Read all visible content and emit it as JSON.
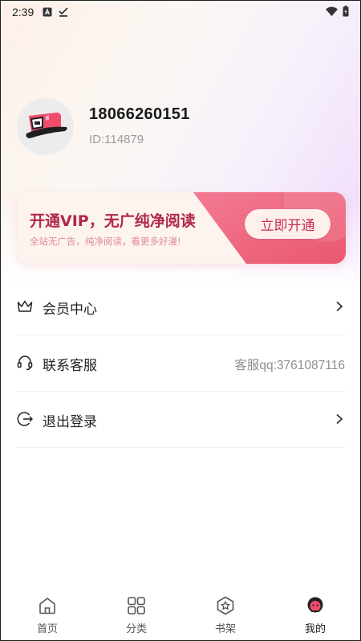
{
  "status_bar": {
    "time": "2:39"
  },
  "profile": {
    "phone": "18066260151",
    "user_id": "ID:114879"
  },
  "vip": {
    "title": "开通VIP，无广纯净阅读",
    "subtitle": "全站无广告，纯净阅读，看更多好漫!",
    "button": "立即开通"
  },
  "menu": [
    {
      "label": "会员中心",
      "icon": "crown-icon"
    },
    {
      "label": "联系客服",
      "icon": "headset-icon",
      "extra": "客服qq:3761087116"
    },
    {
      "label": "退出登录",
      "icon": "logout-icon"
    }
  ],
  "tabs": [
    {
      "label": "首页",
      "icon": "home-icon"
    },
    {
      "label": "分类",
      "icon": "grid-icon"
    },
    {
      "label": "书架",
      "icon": "star-badge-icon"
    },
    {
      "label": "我的",
      "icon": "profile-face-icon",
      "active": true
    }
  ],
  "colors": {
    "accent": "#c52f52",
    "vip_gradient_start": "#f37a93",
    "vip_gradient_end": "#e9586f"
  }
}
